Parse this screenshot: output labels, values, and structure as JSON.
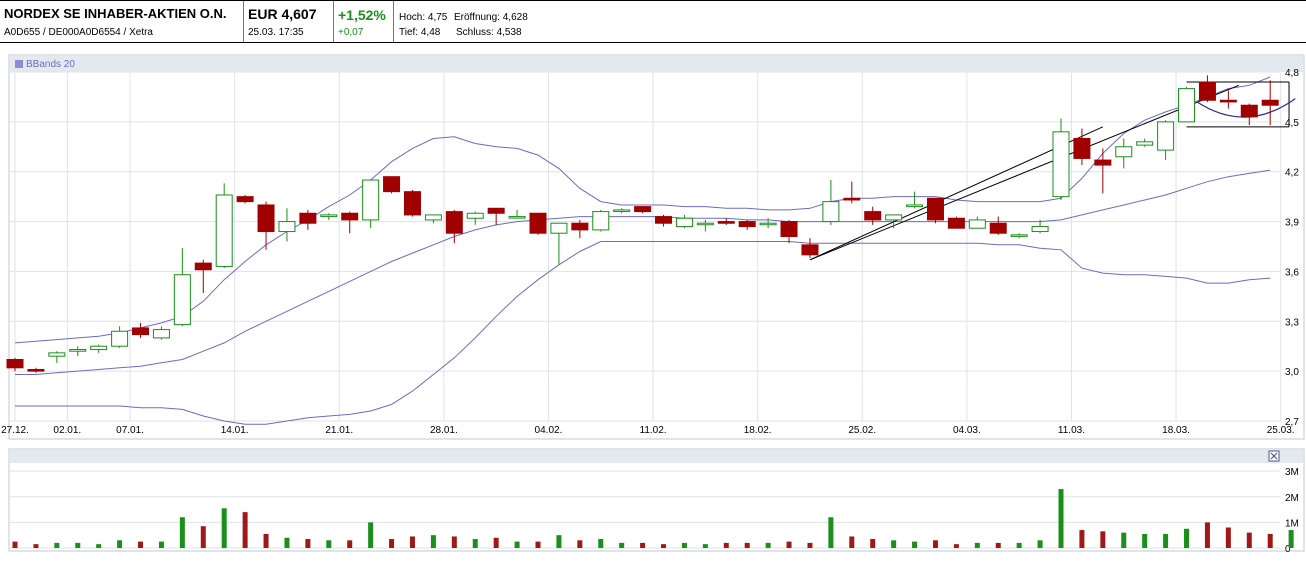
{
  "header": {
    "name": "NORDEX SE INHABER-AKTIEN O.N.",
    "ids": "A0D655 / DE000A0D6554 / Xetra",
    "price": "EUR 4,607",
    "datetime": "25.03. 17:35",
    "change_pct": "+1,52%",
    "change_abs": "+0,07",
    "hoch": "Hoch: 4,75",
    "eroeffnung": "Eröffnung: 4,628",
    "tief": "Tief: 4,48",
    "schluss": "Schluss: 4,538"
  },
  "legend": {
    "bbands": "BBands 20"
  },
  "colors": {
    "up": "#ffffff",
    "up_stroke": "#1a8f1a",
    "down": "#a00000",
    "band": "#6b6bc8",
    "grid": "#dde3ea",
    "vol_up": "#1a8f1a",
    "vol_down": "#a01818"
  },
  "icons": {
    "close": "close-icon"
  },
  "chart_data": [
    {
      "type": "candlestick",
      "ylim": [
        2.7,
        4.8
      ],
      "y_ticks": [
        "4,8",
        "4,5",
        "4,2",
        "3,9",
        "3,6",
        "3,3",
        "3,0",
        "2,7"
      ],
      "y_tick_values": [
        4.8,
        4.5,
        4.2,
        3.9,
        3.6,
        3.3,
        3.0,
        2.7
      ],
      "x_ticks": [
        {
          "label": "27.12.",
          "index": 0
        },
        {
          "label": "02.01.",
          "index": 2.5
        },
        {
          "label": "07.01.",
          "index": 5.5
        },
        {
          "label": "14.01.",
          "index": 10.5
        },
        {
          "label": "21.01.",
          "index": 15.5
        },
        {
          "label": "28.01.",
          "index": 20.5
        },
        {
          "label": "04.02.",
          "index": 25.5
        },
        {
          "label": "11.02.",
          "index": 30.5
        },
        {
          "label": "18.02.",
          "index": 35.5
        },
        {
          "label": "25.02.",
          "index": 40.5
        },
        {
          "label": "04.03.",
          "index": 45.5
        },
        {
          "label": "11.03.",
          "index": 50.5
        },
        {
          "label": "18.03.",
          "index": 55.5
        },
        {
          "label": "25.03.",
          "index": 60.5
        }
      ],
      "candles": [
        {
          "o": 3.07,
          "h": 3.08,
          "l": 3.0,
          "c": 3.02
        },
        {
          "o": 3.01,
          "h": 3.02,
          "l": 2.99,
          "c": 3.0
        },
        {
          "o": 3.09,
          "h": 3.12,
          "l": 3.05,
          "c": 3.11
        },
        {
          "o": 3.12,
          "h": 3.15,
          "l": 3.09,
          "c": 3.13
        },
        {
          "o": 3.13,
          "h": 3.16,
          "l": 3.11,
          "c": 3.15
        },
        {
          "o": 3.15,
          "h": 3.27,
          "l": 3.14,
          "c": 3.24
        },
        {
          "o": 3.26,
          "h": 3.29,
          "l": 3.2,
          "c": 3.22
        },
        {
          "o": 3.2,
          "h": 3.27,
          "l": 3.19,
          "c": 3.25
        },
        {
          "o": 3.28,
          "h": 3.74,
          "l": 3.27,
          "c": 3.58
        },
        {
          "o": 3.65,
          "h": 3.67,
          "l": 3.47,
          "c": 3.61
        },
        {
          "o": 3.63,
          "h": 4.13,
          "l": 3.62,
          "c": 4.06
        },
        {
          "o": 4.05,
          "h": 4.06,
          "l": 4.01,
          "c": 4.02
        },
        {
          "o": 4.0,
          "h": 4.02,
          "l": 3.73,
          "c": 3.84
        },
        {
          "o": 3.84,
          "h": 3.98,
          "l": 3.78,
          "c": 3.9
        },
        {
          "o": 3.95,
          "h": 3.97,
          "l": 3.85,
          "c": 3.89
        },
        {
          "o": 3.93,
          "h": 3.95,
          "l": 3.91,
          "c": 3.94
        },
        {
          "o": 3.95,
          "h": 3.96,
          "l": 3.83,
          "c": 3.91
        },
        {
          "o": 3.91,
          "h": 4.15,
          "l": 3.86,
          "c": 4.15
        },
        {
          "o": 4.17,
          "h": 4.17,
          "l": 4.07,
          "c": 4.08
        },
        {
          "o": 4.08,
          "h": 4.09,
          "l": 3.93,
          "c": 3.94
        },
        {
          "o": 3.91,
          "h": 3.93,
          "l": 3.89,
          "c": 3.94
        },
        {
          "o": 3.96,
          "h": 3.97,
          "l": 3.77,
          "c": 3.83
        },
        {
          "o": 3.92,
          "h": 3.96,
          "l": 3.88,
          "c": 3.95
        },
        {
          "o": 3.98,
          "h": 3.98,
          "l": 3.88,
          "c": 3.95
        },
        {
          "o": 3.93,
          "h": 3.97,
          "l": 3.92,
          "c": 3.93
        },
        {
          "o": 3.95,
          "h": 3.95,
          "l": 3.82,
          "c": 3.83
        },
        {
          "o": 3.83,
          "h": 3.89,
          "l": 3.64,
          "c": 3.89
        },
        {
          "o": 3.89,
          "h": 3.91,
          "l": 3.8,
          "c": 3.85
        },
        {
          "o": 3.85,
          "h": 3.97,
          "l": 3.84,
          "c": 3.96
        },
        {
          "o": 3.97,
          "h": 3.98,
          "l": 3.95,
          "c": 3.97
        },
        {
          "o": 3.99,
          "h": 3.99,
          "l": 3.95,
          "c": 3.96
        },
        {
          "o": 3.93,
          "h": 3.94,
          "l": 3.87,
          "c": 3.89
        },
        {
          "o": 3.87,
          "h": 3.94,
          "l": 3.86,
          "c": 3.92
        },
        {
          "o": 3.89,
          "h": 3.91,
          "l": 3.84,
          "c": 3.89
        },
        {
          "o": 3.9,
          "h": 3.92,
          "l": 3.88,
          "c": 3.89
        },
        {
          "o": 3.9,
          "h": 3.91,
          "l": 3.85,
          "c": 3.87
        },
        {
          "o": 3.89,
          "h": 3.92,
          "l": 3.86,
          "c": 3.89
        },
        {
          "o": 3.9,
          "h": 3.91,
          "l": 3.77,
          "c": 3.81
        },
        {
          "o": 3.76,
          "h": 3.8,
          "l": 3.68,
          "c": 3.7
        },
        {
          "o": 3.9,
          "h": 4.15,
          "l": 3.88,
          "c": 4.02
        },
        {
          "o": 4.04,
          "h": 4.14,
          "l": 4.01,
          "c": 4.03
        },
        {
          "o": 3.96,
          "h": 3.99,
          "l": 3.88,
          "c": 3.91
        },
        {
          "o": 3.91,
          "h": 3.93,
          "l": 3.86,
          "c": 3.94
        },
        {
          "o": 3.99,
          "h": 4.08,
          "l": 3.98,
          "c": 4.0
        },
        {
          "o": 4.04,
          "h": 4.04,
          "l": 3.89,
          "c": 3.91
        },
        {
          "o": 3.92,
          "h": 3.93,
          "l": 3.87,
          "c": 3.86
        },
        {
          "o": 3.86,
          "h": 3.93,
          "l": 3.87,
          "c": 3.91
        },
        {
          "o": 3.89,
          "h": 3.93,
          "l": 3.82,
          "c": 3.83
        },
        {
          "o": 3.82,
          "h": 3.83,
          "l": 3.8,
          "c": 3.82
        },
        {
          "o": 3.84,
          "h": 3.91,
          "l": 3.83,
          "c": 3.87
        },
        {
          "o": 4.05,
          "h": 4.52,
          "l": 4.03,
          "c": 4.44
        },
        {
          "o": 4.4,
          "h": 4.46,
          "l": 4.24,
          "c": 4.28
        },
        {
          "o": 4.27,
          "h": 4.34,
          "l": 4.07,
          "c": 4.24
        },
        {
          "o": 4.29,
          "h": 4.4,
          "l": 4.22,
          "c": 4.35
        },
        {
          "o": 4.36,
          "h": 4.4,
          "l": 4.35,
          "c": 4.38
        },
        {
          "o": 4.33,
          "h": 4.51,
          "l": 4.27,
          "c": 4.5
        },
        {
          "o": 4.5,
          "h": 4.71,
          "l": 4.5,
          "c": 4.7
        },
        {
          "o": 4.74,
          "h": 4.78,
          "l": 4.62,
          "c": 4.63
        },
        {
          "o": 4.63,
          "h": 4.69,
          "l": 4.58,
          "c": 4.62
        },
        {
          "o": 4.6,
          "h": 4.61,
          "l": 4.48,
          "c": 4.53
        },
        {
          "o": 4.63,
          "h": 4.75,
          "l": 4.48,
          "c": 4.6
        }
      ],
      "bb_upper": [
        3.17,
        3.18,
        3.19,
        3.2,
        3.21,
        3.23,
        3.26,
        3.29,
        3.33,
        3.42,
        3.55,
        3.66,
        3.76,
        3.84,
        3.91,
        3.99,
        4.06,
        4.15,
        4.26,
        4.34,
        4.4,
        4.41,
        4.37,
        4.35,
        4.34,
        4.3,
        4.22,
        4.1,
        4.02,
        4.0,
        4.0,
        4.0,
        3.99,
        3.99,
        3.98,
        3.98,
        3.97,
        3.97,
        3.98,
        4.02,
        4.04,
        4.04,
        4.05,
        4.05,
        4.05,
        4.03,
        4.02,
        4.02,
        4.02,
        4.02,
        4.04,
        4.16,
        4.31,
        4.43,
        4.51,
        4.56,
        4.6,
        4.65,
        4.7,
        4.72,
        4.77
      ],
      "bb_middle": [
        2.98,
        2.98,
        2.99,
        3.0,
        3.01,
        3.02,
        3.03,
        3.05,
        3.07,
        3.12,
        3.17,
        3.24,
        3.3,
        3.36,
        3.42,
        3.48,
        3.54,
        3.6,
        3.66,
        3.71,
        3.76,
        3.81,
        3.85,
        3.88,
        3.9,
        3.91,
        3.92,
        3.93,
        3.93,
        3.93,
        3.93,
        3.93,
        3.92,
        3.92,
        3.92,
        3.91,
        3.91,
        3.9,
        3.9,
        3.9,
        3.9,
        3.9,
        3.9,
        3.9,
        3.9,
        3.9,
        3.9,
        3.9,
        3.9,
        3.9,
        3.91,
        3.94,
        3.97,
        4.0,
        4.03,
        4.06,
        4.1,
        4.14,
        4.17,
        4.19,
        4.21
      ],
      "bb_lower": [
        2.79,
        2.79,
        2.79,
        2.79,
        2.79,
        2.79,
        2.78,
        2.78,
        2.77,
        2.73,
        2.7,
        2.68,
        2.68,
        2.7,
        2.72,
        2.73,
        2.74,
        2.76,
        2.8,
        2.88,
        2.98,
        3.08,
        3.2,
        3.33,
        3.45,
        3.55,
        3.64,
        3.72,
        3.78,
        3.78,
        3.78,
        3.78,
        3.78,
        3.78,
        3.78,
        3.78,
        3.78,
        3.78,
        3.77,
        3.77,
        3.77,
        3.77,
        3.77,
        3.77,
        3.77,
        3.77,
        3.77,
        3.76,
        3.76,
        3.74,
        3.73,
        3.62,
        3.59,
        3.58,
        3.58,
        3.57,
        3.56,
        3.53,
        3.53,
        3.55,
        3.56
      ],
      "trend_channel": [
        {
          "from": [
            38,
            3.67
          ],
          "to": [
            58.5,
            4.72
          ]
        },
        {
          "from": [
            38,
            3.67
          ],
          "to": [
            52,
            4.47
          ]
        }
      ],
      "rectangle": {
        "x0": 56,
        "x1": 60.9,
        "ytop": 4.74,
        "ybot": 4.47
      },
      "cup": {
        "x0": 56.5,
        "x1": 61.2,
        "ybot": 4.5,
        "yend": 4.64
      }
    },
    {
      "type": "bar",
      "y_ticks": [
        "3M",
        "2M",
        "1M",
        "0"
      ],
      "y_tick_values": [
        3,
        2,
        1,
        0
      ],
      "ylim": [
        0,
        3.2
      ],
      "volumes": [
        0.25,
        0.15,
        0.2,
        0.2,
        0.15,
        0.3,
        0.25,
        0.25,
        1.2,
        0.85,
        1.55,
        1.4,
        0.55,
        0.4,
        0.35,
        0.3,
        0.3,
        1.0,
        0.35,
        0.45,
        0.5,
        0.45,
        0.35,
        0.4,
        0.25,
        0.25,
        0.5,
        0.3,
        0.35,
        0.2,
        0.2,
        0.15,
        0.2,
        0.15,
        0.2,
        0.2,
        0.2,
        0.25,
        0.2,
        1.2,
        0.45,
        0.35,
        0.3,
        0.25,
        0.3,
        0.15,
        0.2,
        0.2,
        0.2,
        0.3,
        2.3,
        0.7,
        0.65,
        0.6,
        0.55,
        0.55,
        0.75,
        1.0,
        0.8,
        0.6,
        0.55,
        0.7
      ]
    }
  ]
}
